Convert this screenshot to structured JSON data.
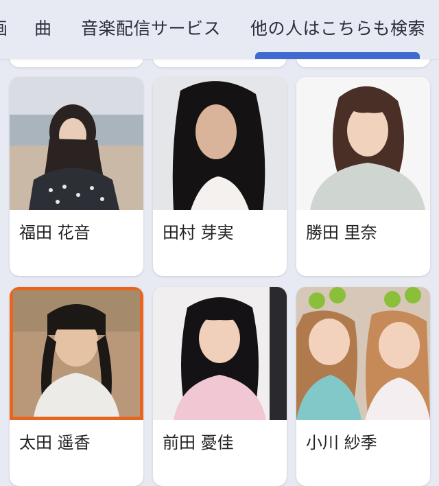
{
  "tabs": [
    {
      "label": "画"
    },
    {
      "label": "曲"
    },
    {
      "label": "音楽配信サービス"
    },
    {
      "label": "他の人はこちらも検索"
    }
  ],
  "cards": [
    {
      "name": "福田 花音"
    },
    {
      "name": "田村 芽実"
    },
    {
      "name": "勝田 里奈"
    },
    {
      "name": "太田 遥香"
    },
    {
      "name": "前田 憂佳"
    },
    {
      "name": "小川 紗季"
    }
  ],
  "colors": {
    "background": "#e8eaf3",
    "active_tab_indicator": "#3f6bd1",
    "selected_card_border": "#e8651e"
  }
}
